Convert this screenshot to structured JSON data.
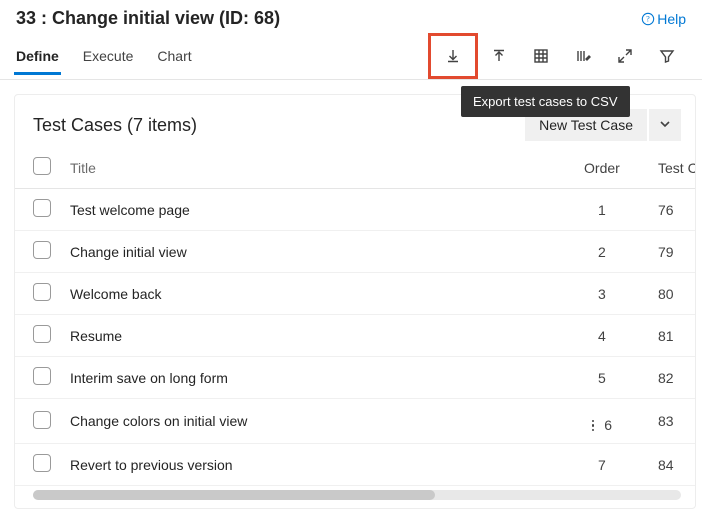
{
  "header": {
    "title": "33 : Change initial view (ID: 68)",
    "help_label": "Help"
  },
  "tabs": {
    "define": "Define",
    "execute": "Execute",
    "chart": "Chart"
  },
  "toolbar": {
    "tooltip_export": "Export test cases to CSV"
  },
  "panel": {
    "title": "Test Cases (7 items)",
    "new_btn": "New Test Case"
  },
  "columns": {
    "title": "Title",
    "order": "Order",
    "testca": "Test Ca"
  },
  "rows": [
    {
      "title": "Test welcome page",
      "order": "1",
      "tc": "76",
      "menu": false
    },
    {
      "title": "Change initial view",
      "order": "2",
      "tc": "79",
      "menu": false
    },
    {
      "title": "Welcome back",
      "order": "3",
      "tc": "80",
      "menu": false
    },
    {
      "title": "Resume",
      "order": "4",
      "tc": "81",
      "menu": false
    },
    {
      "title": "Interim save on long form",
      "order": "5",
      "tc": "82",
      "menu": false
    },
    {
      "title": "Change colors on initial view",
      "order": "6",
      "tc": "83",
      "menu": true
    },
    {
      "title": "Revert to previous version",
      "order": "7",
      "tc": "84",
      "menu": false
    }
  ]
}
